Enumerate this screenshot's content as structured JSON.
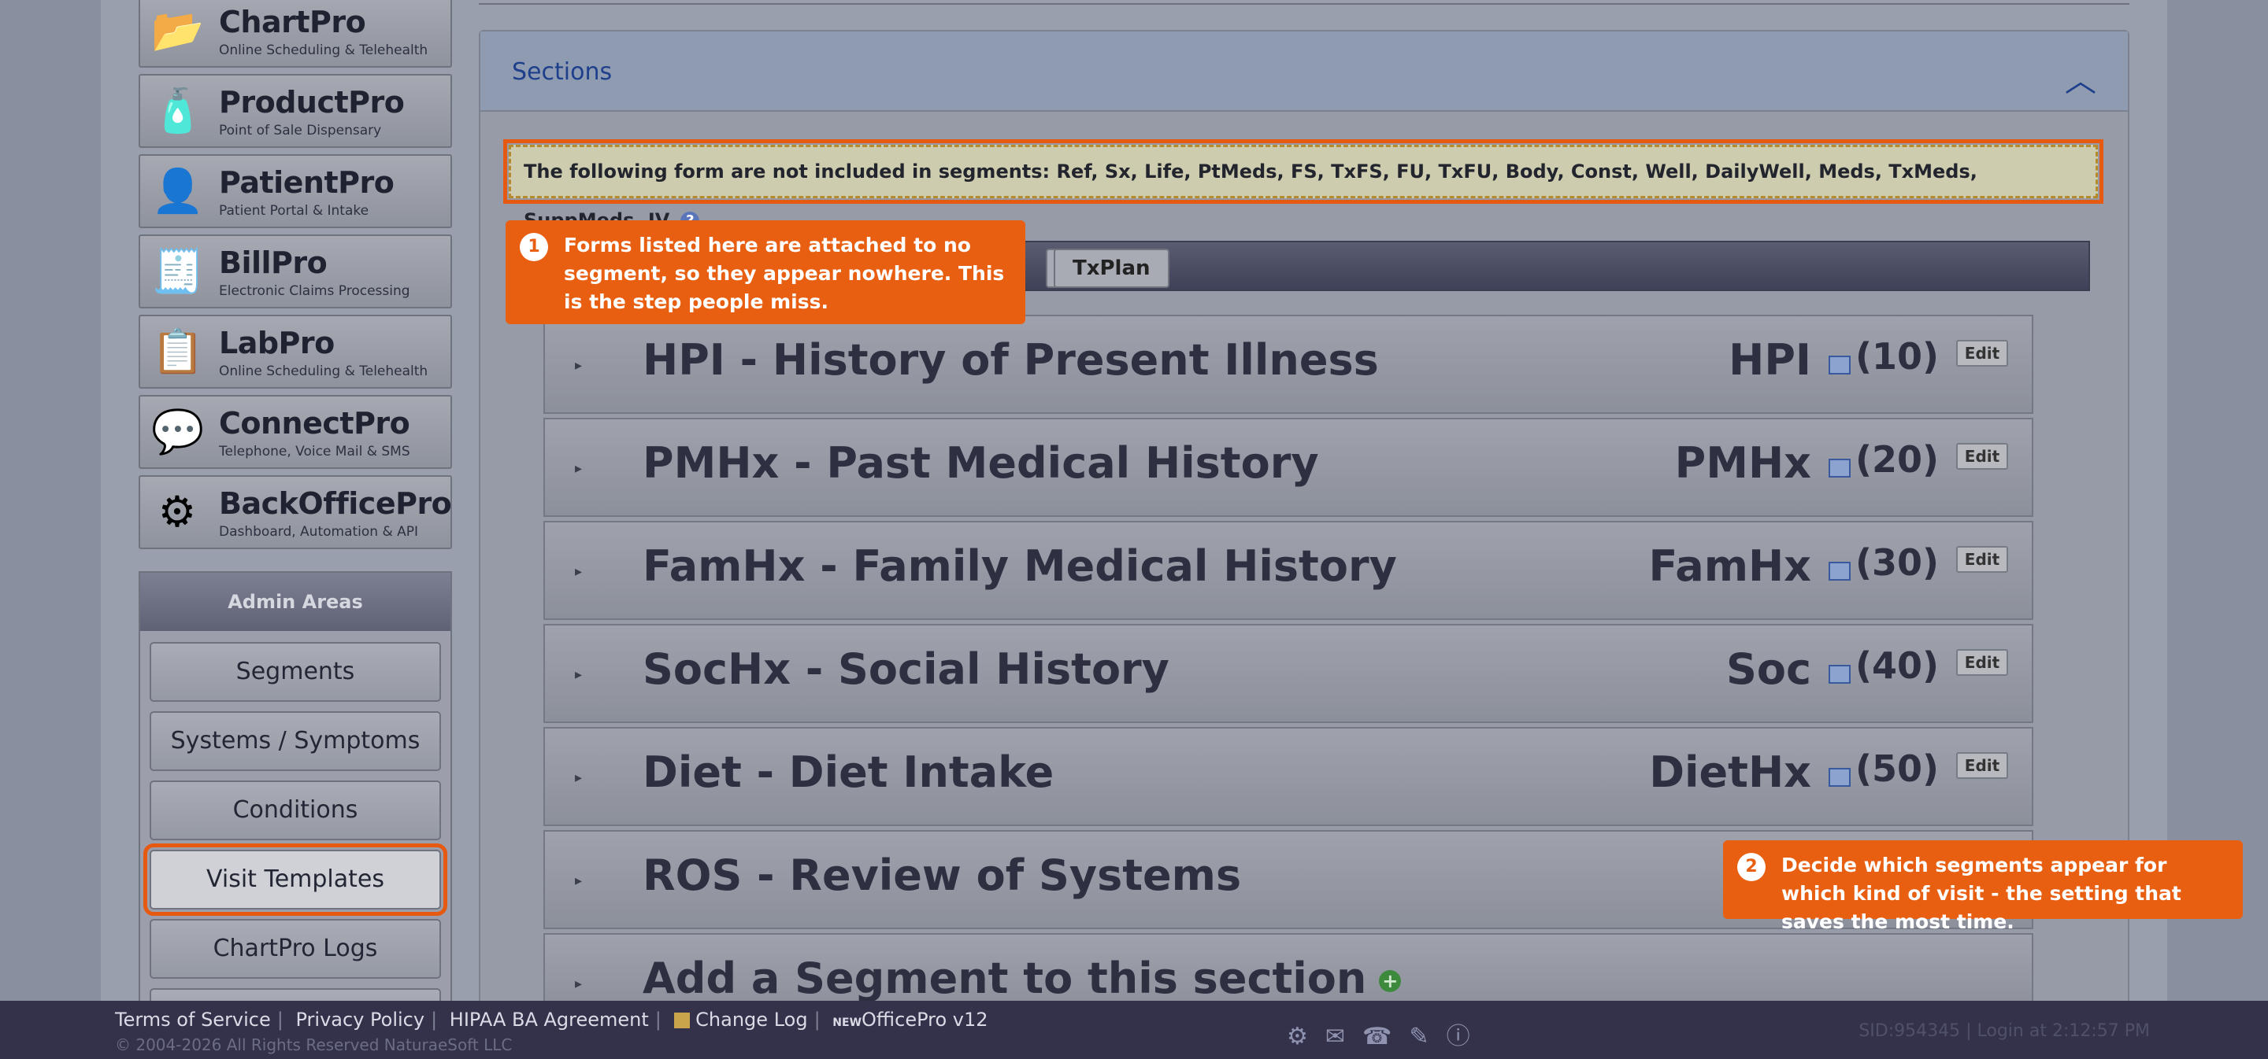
{
  "products": [
    {
      "name": "ChartPro",
      "sub": "Online Scheduling & Telehealth",
      "icon": "folder-icon",
      "glyph": "📂"
    },
    {
      "name": "ProductPro",
      "sub": "Point of Sale Dispensary",
      "icon": "bottle-icon",
      "glyph": "🧴"
    },
    {
      "name": "PatientPro",
      "sub": "Patient Portal & Intake",
      "icon": "patient-icon",
      "glyph": "👤"
    },
    {
      "name": "BillPro",
      "sub": "Electronic Claims Processing",
      "icon": "bill-icon",
      "glyph": "🧾"
    },
    {
      "name": "LabPro",
      "sub": "Online Scheduling & Telehealth",
      "icon": "lab-icon",
      "glyph": "📋"
    },
    {
      "name": "ConnectPro",
      "sub": "Telephone, Voice Mail & SMS",
      "icon": "chat-icon",
      "glyph": "💬"
    },
    {
      "name": "BackOfficePro",
      "sub": "Dashboard, Automation & API",
      "icon": "gear-icon",
      "glyph": "⚙"
    }
  ],
  "admin": {
    "title": "Admin Areas",
    "items": [
      "Segments",
      "Systems / Symptoms",
      "Conditions",
      "Visit Templates",
      "ChartPro Logs"
    ]
  },
  "sections": {
    "title": "Sections",
    "chevron": "︿",
    "notice": "The following form are not included in segments: Ref,  Sx,  Life,  PtMeds,  FS,  TxFS,  FU,  TxFU,  Body,  Const,  Well,  DailyWell,  Meds,  TxMeds,  SuppMeds,  IV,",
    "help": "?",
    "tabs": [
      "TxPlan"
    ],
    "segments": [
      {
        "title": "HPI - History of Present Illness",
        "abbr": "HPI",
        "count": "(10)",
        "edit": "Edit"
      },
      {
        "title": "PMHx - Past Medical History",
        "abbr": "PMHx",
        "count": "(20)",
        "edit": "Edit"
      },
      {
        "title": "FamHx - Family Medical History",
        "abbr": "FamHx",
        "count": "(30)",
        "edit": "Edit"
      },
      {
        "title": "SocHx - Social History",
        "abbr": "Soc",
        "count": "(40)",
        "edit": "Edit"
      },
      {
        "title": "Diet - Diet Intake",
        "abbr": "DietHx",
        "count": "(50)",
        "edit": "Edit"
      },
      {
        "title": "ROS - Review of Systems",
        "abbr": "",
        "count": "",
        "edit": ""
      }
    ],
    "add_segment": "Add a Segment to this section",
    "plus": "+"
  },
  "callouts": [
    {
      "num": "1",
      "text": "Forms listed here are attached to no segment, so they appear nowhere. This is the step people miss."
    },
    {
      "num": "2",
      "text": "Decide which segments appear for which kind of visit - the setting that saves the most time."
    }
  ],
  "footer": {
    "links": [
      "Terms of Service",
      "Privacy Policy",
      "HIPAA BA Agreement",
      "Change Log"
    ],
    "new_tag": "NEW",
    "version": "OfficePro v12",
    "copyright": "© 2004-2026 All Rights Reserved NaturaeSoft LLC",
    "icons": [
      "gear-icon",
      "chat-icon",
      "phone-icon",
      "tag-icon",
      "help-icon"
    ],
    "session": "SID:954345 | Login at 2:12:57 PM"
  }
}
